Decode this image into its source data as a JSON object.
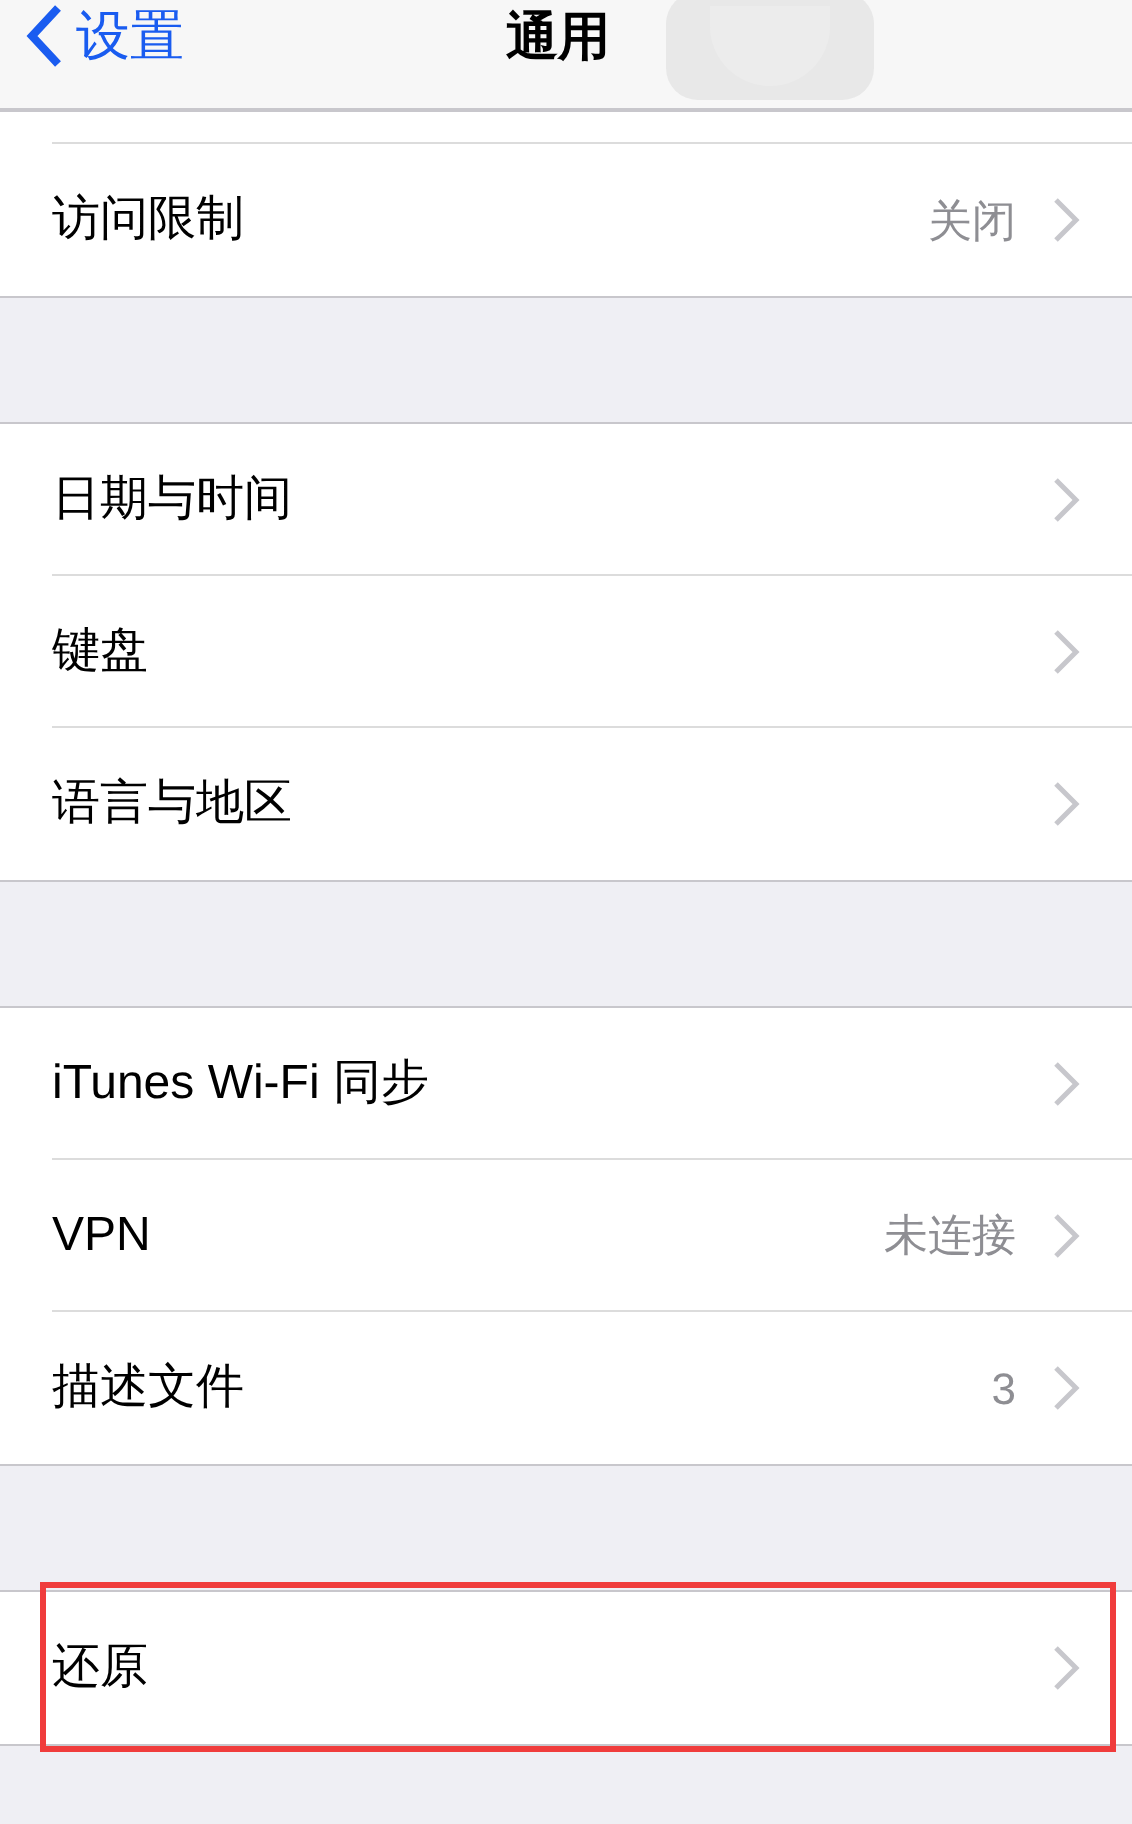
{
  "nav_bar": {
    "back_label": "设置",
    "title": "通用"
  },
  "sections": [
    {
      "clipped_top": true,
      "rows": [
        {
          "label": "访问限制",
          "value": "关闭",
          "highlighted": false
        }
      ]
    },
    {
      "clipped_top": false,
      "rows": [
        {
          "label": "日期与时间",
          "highlighted": false
        },
        {
          "label": "键盘",
          "highlighted": false
        },
        {
          "label": "语言与地区",
          "highlighted": false
        }
      ]
    },
    {
      "clipped_top": false,
      "rows": [
        {
          "label": "iTunes Wi-Fi 同步",
          "highlighted": false
        },
        {
          "label": "VPN",
          "value": "未连接",
          "highlighted": false
        },
        {
          "label": "描述文件",
          "value": "3",
          "highlighted": false
        }
      ]
    },
    {
      "clipped_top": false,
      "rows": [
        {
          "label": "还原",
          "highlighted": true
        }
      ]
    }
  ]
}
